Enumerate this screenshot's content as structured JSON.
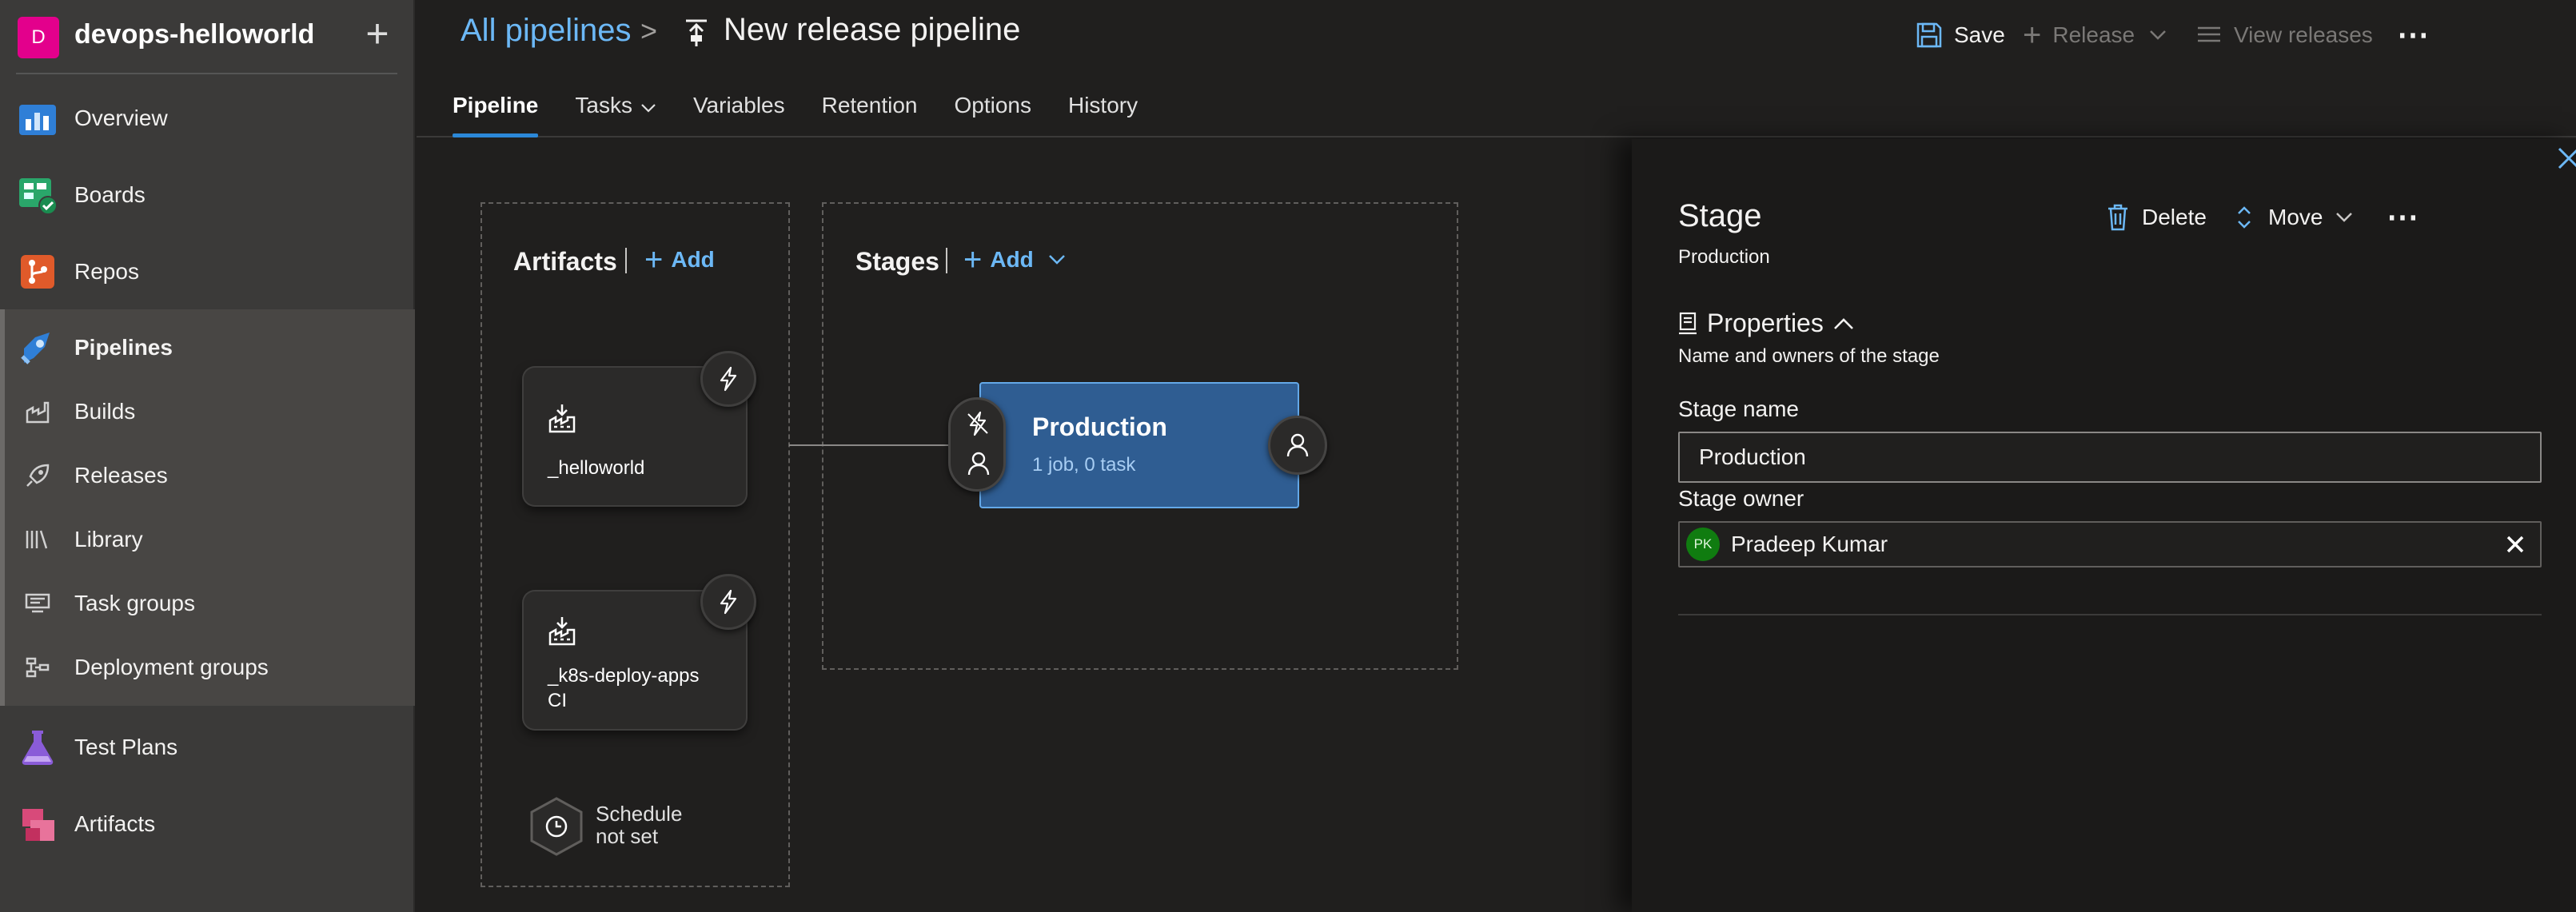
{
  "org": {
    "initial": "D",
    "name": "devops-helloworld"
  },
  "nav": {
    "overview": "Overview",
    "boards": "Boards",
    "repos": "Repos",
    "pipelines": "Pipelines",
    "builds": "Builds",
    "releases": "Releases",
    "library": "Library",
    "task_groups": "Task groups",
    "deployment_groups": "Deployment groups",
    "test_plans": "Test Plans",
    "artifacts": "Artifacts"
  },
  "breadcrumb": {
    "parent": "All pipelines",
    "separator": ">",
    "title": "New release pipeline"
  },
  "commands": {
    "save": "Save",
    "release": "Release",
    "view_releases": "View releases",
    "more": "⋯"
  },
  "tabs": [
    "Pipeline",
    "Tasks",
    "Variables",
    "Retention",
    "Options",
    "History"
  ],
  "artifacts_panel": {
    "title": "Artifacts",
    "add": "Add",
    "items": [
      {
        "name": "_helloworld"
      },
      {
        "name_line1": "_k8s-deploy-apps",
        "name_line2": "CI"
      }
    ],
    "schedule_line1": "Schedule",
    "schedule_line2": "not set"
  },
  "stages_panel": {
    "title": "Stages",
    "add": "Add",
    "stage": {
      "name": "Production",
      "summary": "1 job, 0 task"
    }
  },
  "stage_details": {
    "title": "Stage",
    "subtitle": "Production",
    "delete": "Delete",
    "move": "Move",
    "more": "⋯",
    "section_title": "Properties",
    "section_subtitle": "Name and owners of the stage",
    "stage_name_label": "Stage name",
    "stage_name_value": "Production",
    "stage_owner_label": "Stage owner",
    "owner_initials": "PK",
    "owner_name": "Pradeep Kumar"
  },
  "colors": {
    "accent": "#2b88d8",
    "link": "#6cb8f6",
    "stage_card": "#2f5d92",
    "org_badge": "#e3008c"
  }
}
